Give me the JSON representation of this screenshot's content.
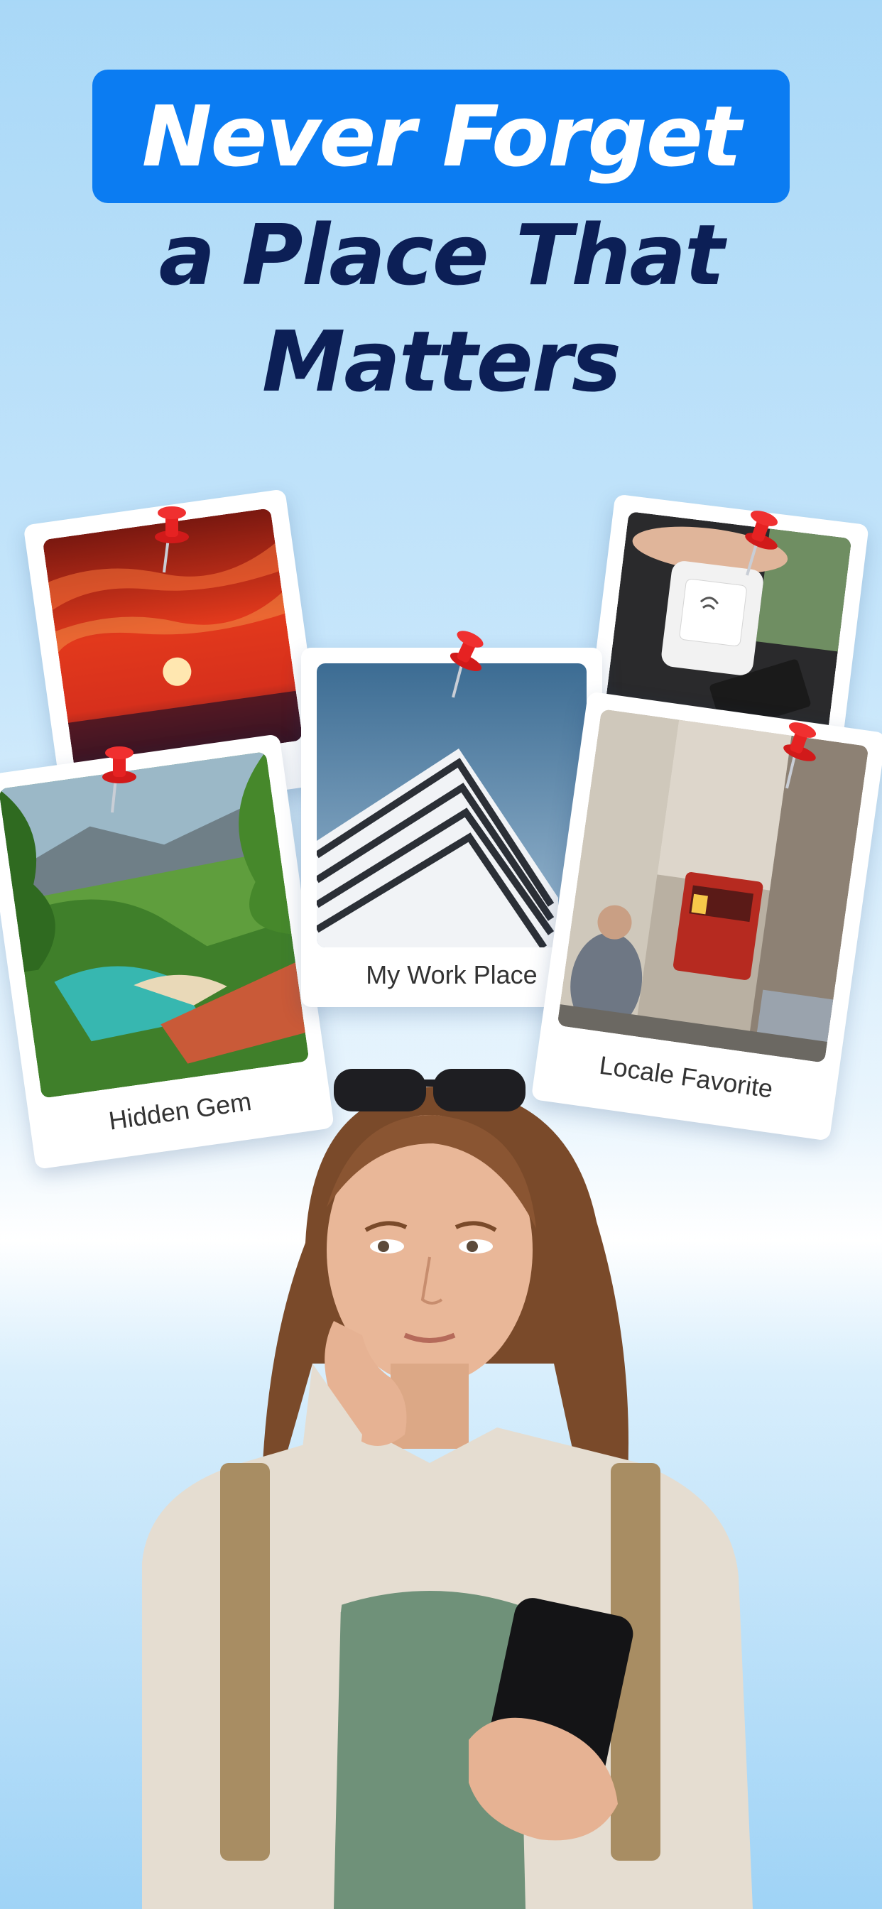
{
  "headline": {
    "line1": "Never Forget",
    "line2": "a Place That",
    "line3": "Matters",
    "highlight_color": "#0b7cf2",
    "text_color": "#0c1f56"
  },
  "cards": [
    {
      "name": "sunset",
      "caption": ""
    },
    {
      "name": "card-payment",
      "caption": ""
    },
    {
      "name": "hidden-gem",
      "caption": "Hidden Gem"
    },
    {
      "name": "work-place",
      "caption": "My Work Place"
    },
    {
      "name": "locale-favorite",
      "caption": "Locale Favorite"
    }
  ],
  "icons": {
    "pin": "push-pin-icon"
  }
}
